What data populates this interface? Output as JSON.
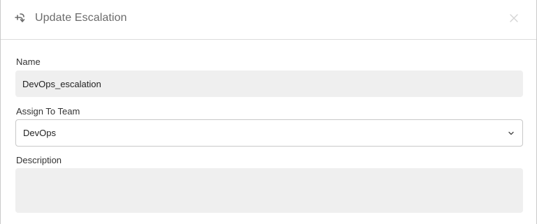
{
  "dialog": {
    "title": "Update Escalation",
    "icons": {
      "header": "merge-arrow-icon",
      "close": "close-icon",
      "dropdown": "chevron-down-icon"
    }
  },
  "form": {
    "name": {
      "label": "Name",
      "value": "DevOps_escalation"
    },
    "team": {
      "label": "Assign To Team",
      "selected": "DevOps"
    },
    "description": {
      "label": "Description",
      "value": ""
    }
  },
  "colors": {
    "input_bg": "#efefef",
    "border": "#c8c8c8",
    "title_text": "#6b6b6b"
  }
}
